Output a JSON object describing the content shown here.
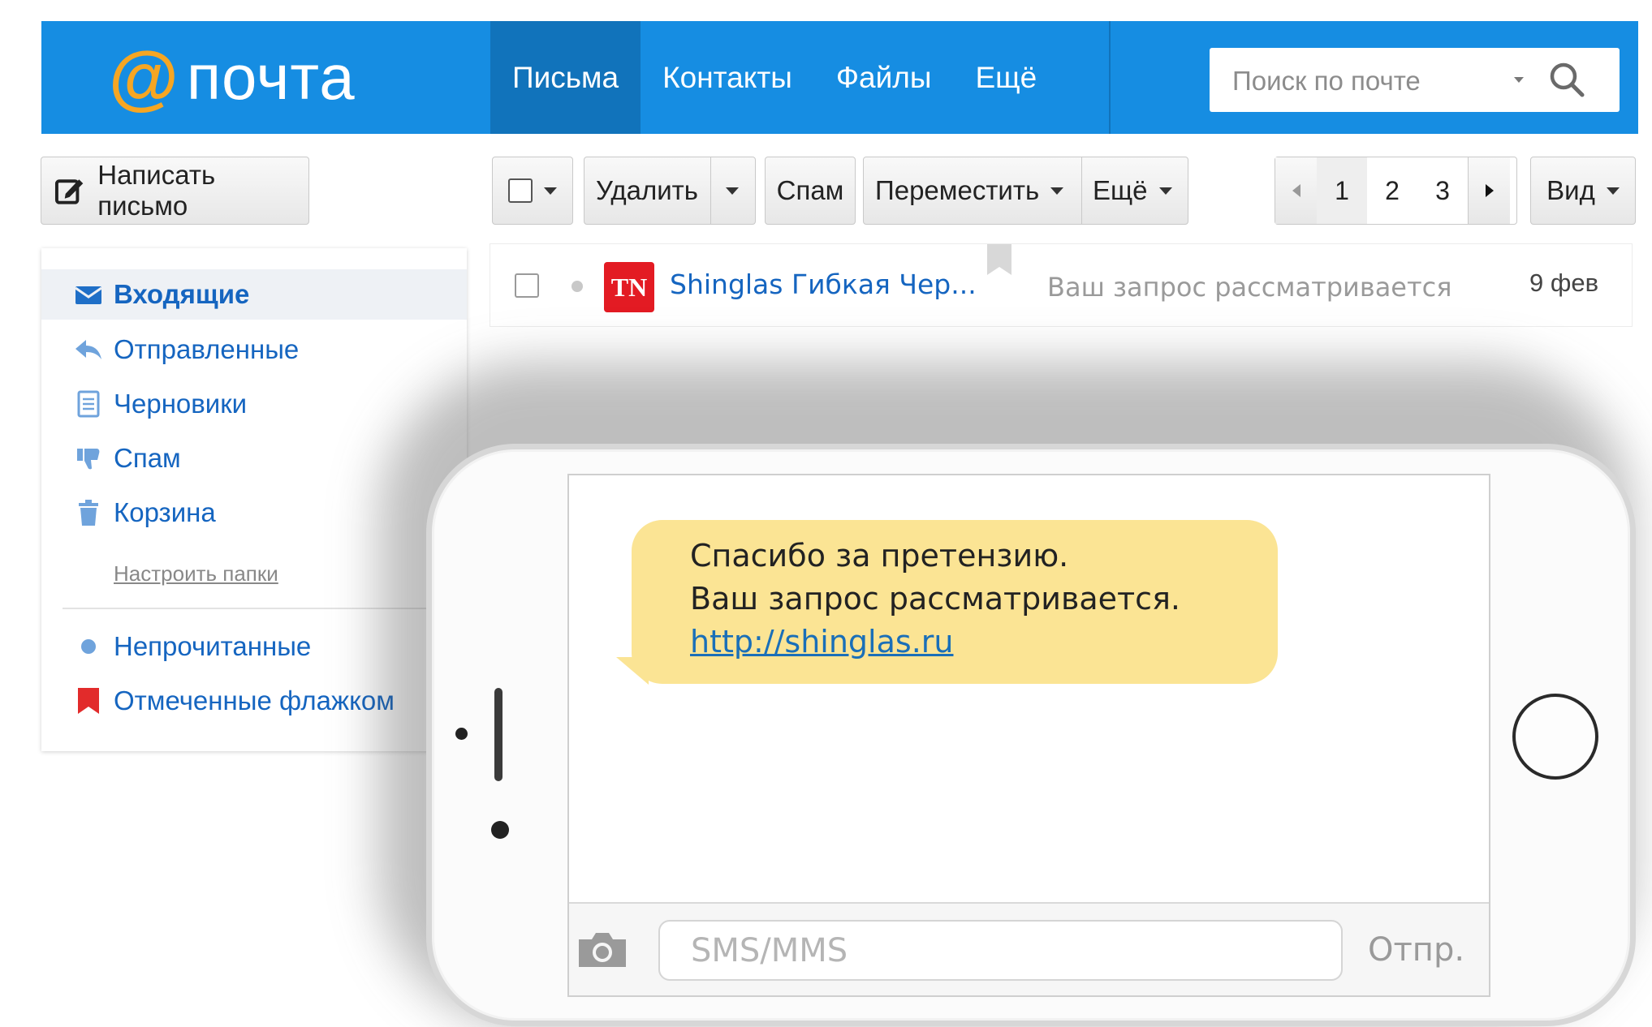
{
  "header": {
    "logo_at": "@",
    "logo_text": "почта",
    "tabs": [
      {
        "label": "Письма",
        "active": true
      },
      {
        "label": "Контакты"
      },
      {
        "label": "Файлы"
      },
      {
        "label": "Ещё"
      }
    ],
    "search_placeholder": "Поиск по почте",
    "search_icon": "search-icon",
    "brand_color": "#168de2",
    "logo_color": "#f6a623"
  },
  "toolbar": {
    "compose_label": "Написать письмо",
    "delete_label": "Удалить",
    "spam_label": "Спам",
    "move_label": "Переместить",
    "more_label": "Ещё",
    "pages": [
      "1",
      "2",
      "3"
    ],
    "current_page": "1",
    "view_label": "Вид"
  },
  "sidebar": {
    "folders": [
      {
        "label": "Входящие",
        "icon": "envelope-icon",
        "active": true
      },
      {
        "label": "Отправленные",
        "icon": "reply-icon"
      },
      {
        "label": "Черновики",
        "icon": "draft-icon"
      },
      {
        "label": "Спам",
        "icon": "thumbs-down-icon"
      },
      {
        "label": "Корзина",
        "icon": "trash-icon"
      }
    ],
    "setup_link": "Настроить папки",
    "filters": [
      {
        "label": "Непрочитанные",
        "icon": "unread-dot-icon"
      },
      {
        "label": "Отмеченные флажком",
        "icon": "flag-icon"
      }
    ]
  },
  "messages": [
    {
      "logo_text": "TN",
      "sender": "Shinglas Гибкая Чер...",
      "subject": "Ваш запрос рассматривается",
      "date": "9 фев"
    }
  ],
  "phone": {
    "sms_lines": [
      "Спасибо за претензию.",
      "Ваш запрос рассматривается."
    ],
    "sms_link": "http://shinglas.ru",
    "input_placeholder": "SMS/MMS",
    "send_label": "Отпр.",
    "bubble_color": "#fbe494"
  }
}
